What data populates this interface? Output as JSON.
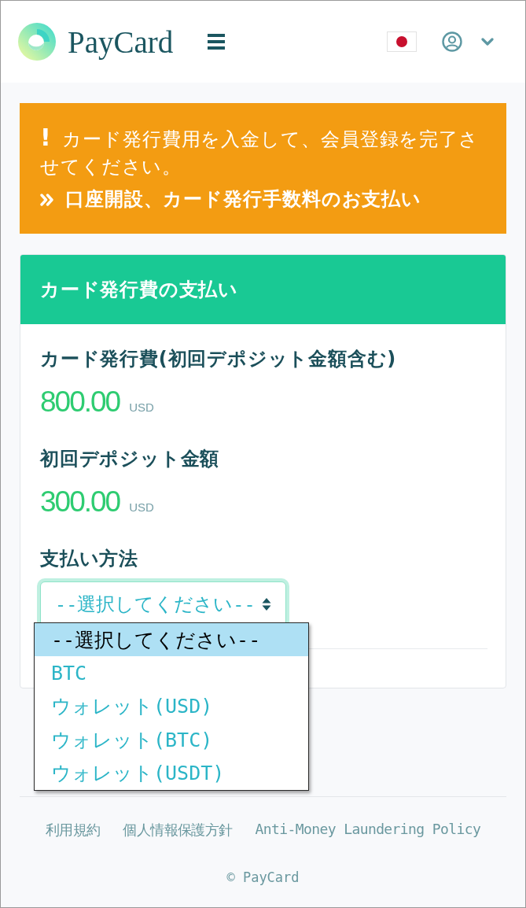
{
  "header": {
    "brand": "PayCard"
  },
  "alert": {
    "message": "**!** カード発行費用を入金して、会員登録を完了させてください。",
    "link": "口座開設、カード発行手数料のお支払い"
  },
  "card": {
    "title": "カード発行費の支払い",
    "fields": [
      {
        "label": "カード発行費(初回デポジット金額含む)",
        "amount": "800.00",
        "currency": "USD"
      },
      {
        "label": "初回デポジット金額",
        "amount": "300.00",
        "currency": "USD"
      }
    ],
    "payment": {
      "label": "支払い方法",
      "select": {
        "value": "--選択してください--",
        "expanded": true,
        "options": [
          {
            "label": "--選択してください--",
            "selected": true
          },
          {
            "label": "BTC",
            "selected": false
          },
          {
            "label": "ウォレット(USD)",
            "selected": false
          },
          {
            "label": "ウォレット(BTC)",
            "selected": false
          },
          {
            "label": "ウォレット(USDT)",
            "selected": false
          }
        ]
      }
    }
  },
  "footer": {
    "links": [
      "利用規約",
      "個人情報保護方針",
      "Anti-Money Laundering Policy"
    ],
    "copyright": "© PayCard"
  }
}
